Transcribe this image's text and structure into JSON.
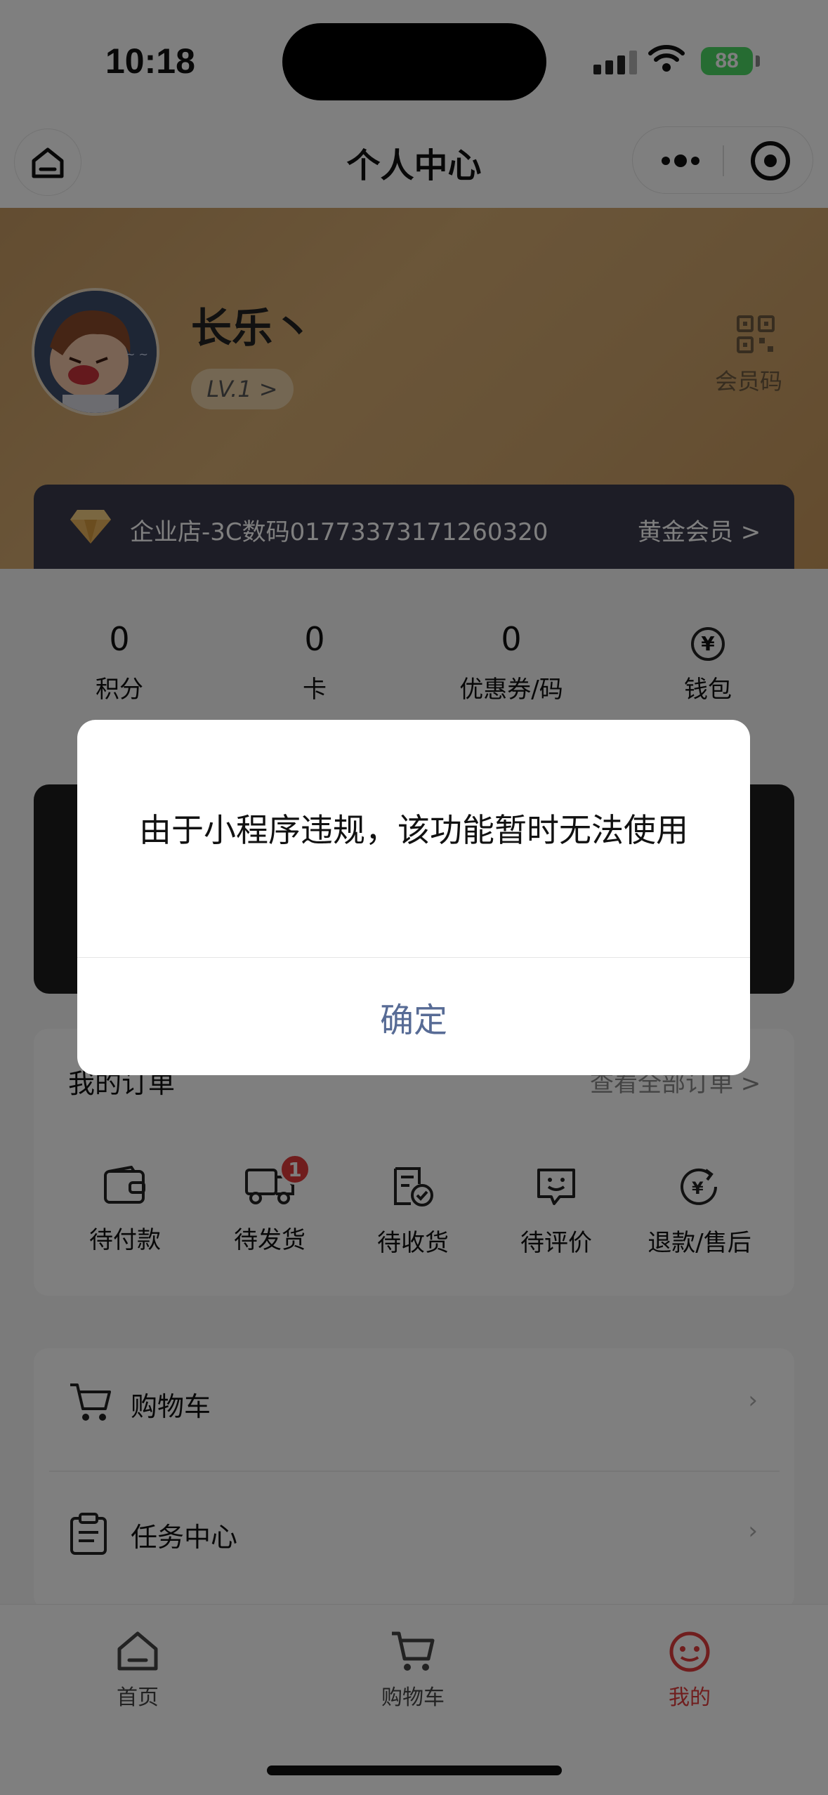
{
  "status_bar": {
    "time": "10:18",
    "battery": "88"
  },
  "nav": {
    "title": "个人中心"
  },
  "profile": {
    "name": "长乐丶",
    "level": "LV.1 >",
    "qr_label": "会员码",
    "store": "企业店-3C数码01773373171260320",
    "tier": "黄金会员 >"
  },
  "stats": [
    {
      "value": "0",
      "label": "积分"
    },
    {
      "value": "0",
      "label": "卡"
    },
    {
      "value": "0",
      "label": "优惠券/码"
    },
    {
      "value": "",
      "label": "钱包",
      "icon": "yen-wallet-icon"
    }
  ],
  "orders": {
    "title": "我的订单",
    "view_all": "查看全部订单 >",
    "items": [
      {
        "label": "待付款",
        "icon": "wallet-icon"
      },
      {
        "label": "待发货",
        "icon": "truck-icon",
        "badge": "1"
      },
      {
        "label": "待收货",
        "icon": "receipt-check-icon"
      },
      {
        "label": "待评价",
        "icon": "smile-chat-icon"
      },
      {
        "label": "退款/售后",
        "icon": "refund-icon"
      }
    ]
  },
  "menu": [
    {
      "label": "购物车",
      "icon": "cart-icon"
    },
    {
      "label": "任务中心",
      "icon": "clipboard-icon"
    }
  ],
  "tabbar": [
    {
      "label": "首页",
      "icon": "home-icon"
    },
    {
      "label": "购物车",
      "icon": "cart-icon"
    },
    {
      "label": "我的",
      "icon": "profile-icon",
      "active": true
    }
  ],
  "modal": {
    "message": "由于小程序违规，该功能暂时无法使用",
    "confirm": "确定"
  },
  "colors": {
    "accent": "#e03c3c",
    "modal_button": "#576b95",
    "member_bar": "#3b3a4d"
  }
}
